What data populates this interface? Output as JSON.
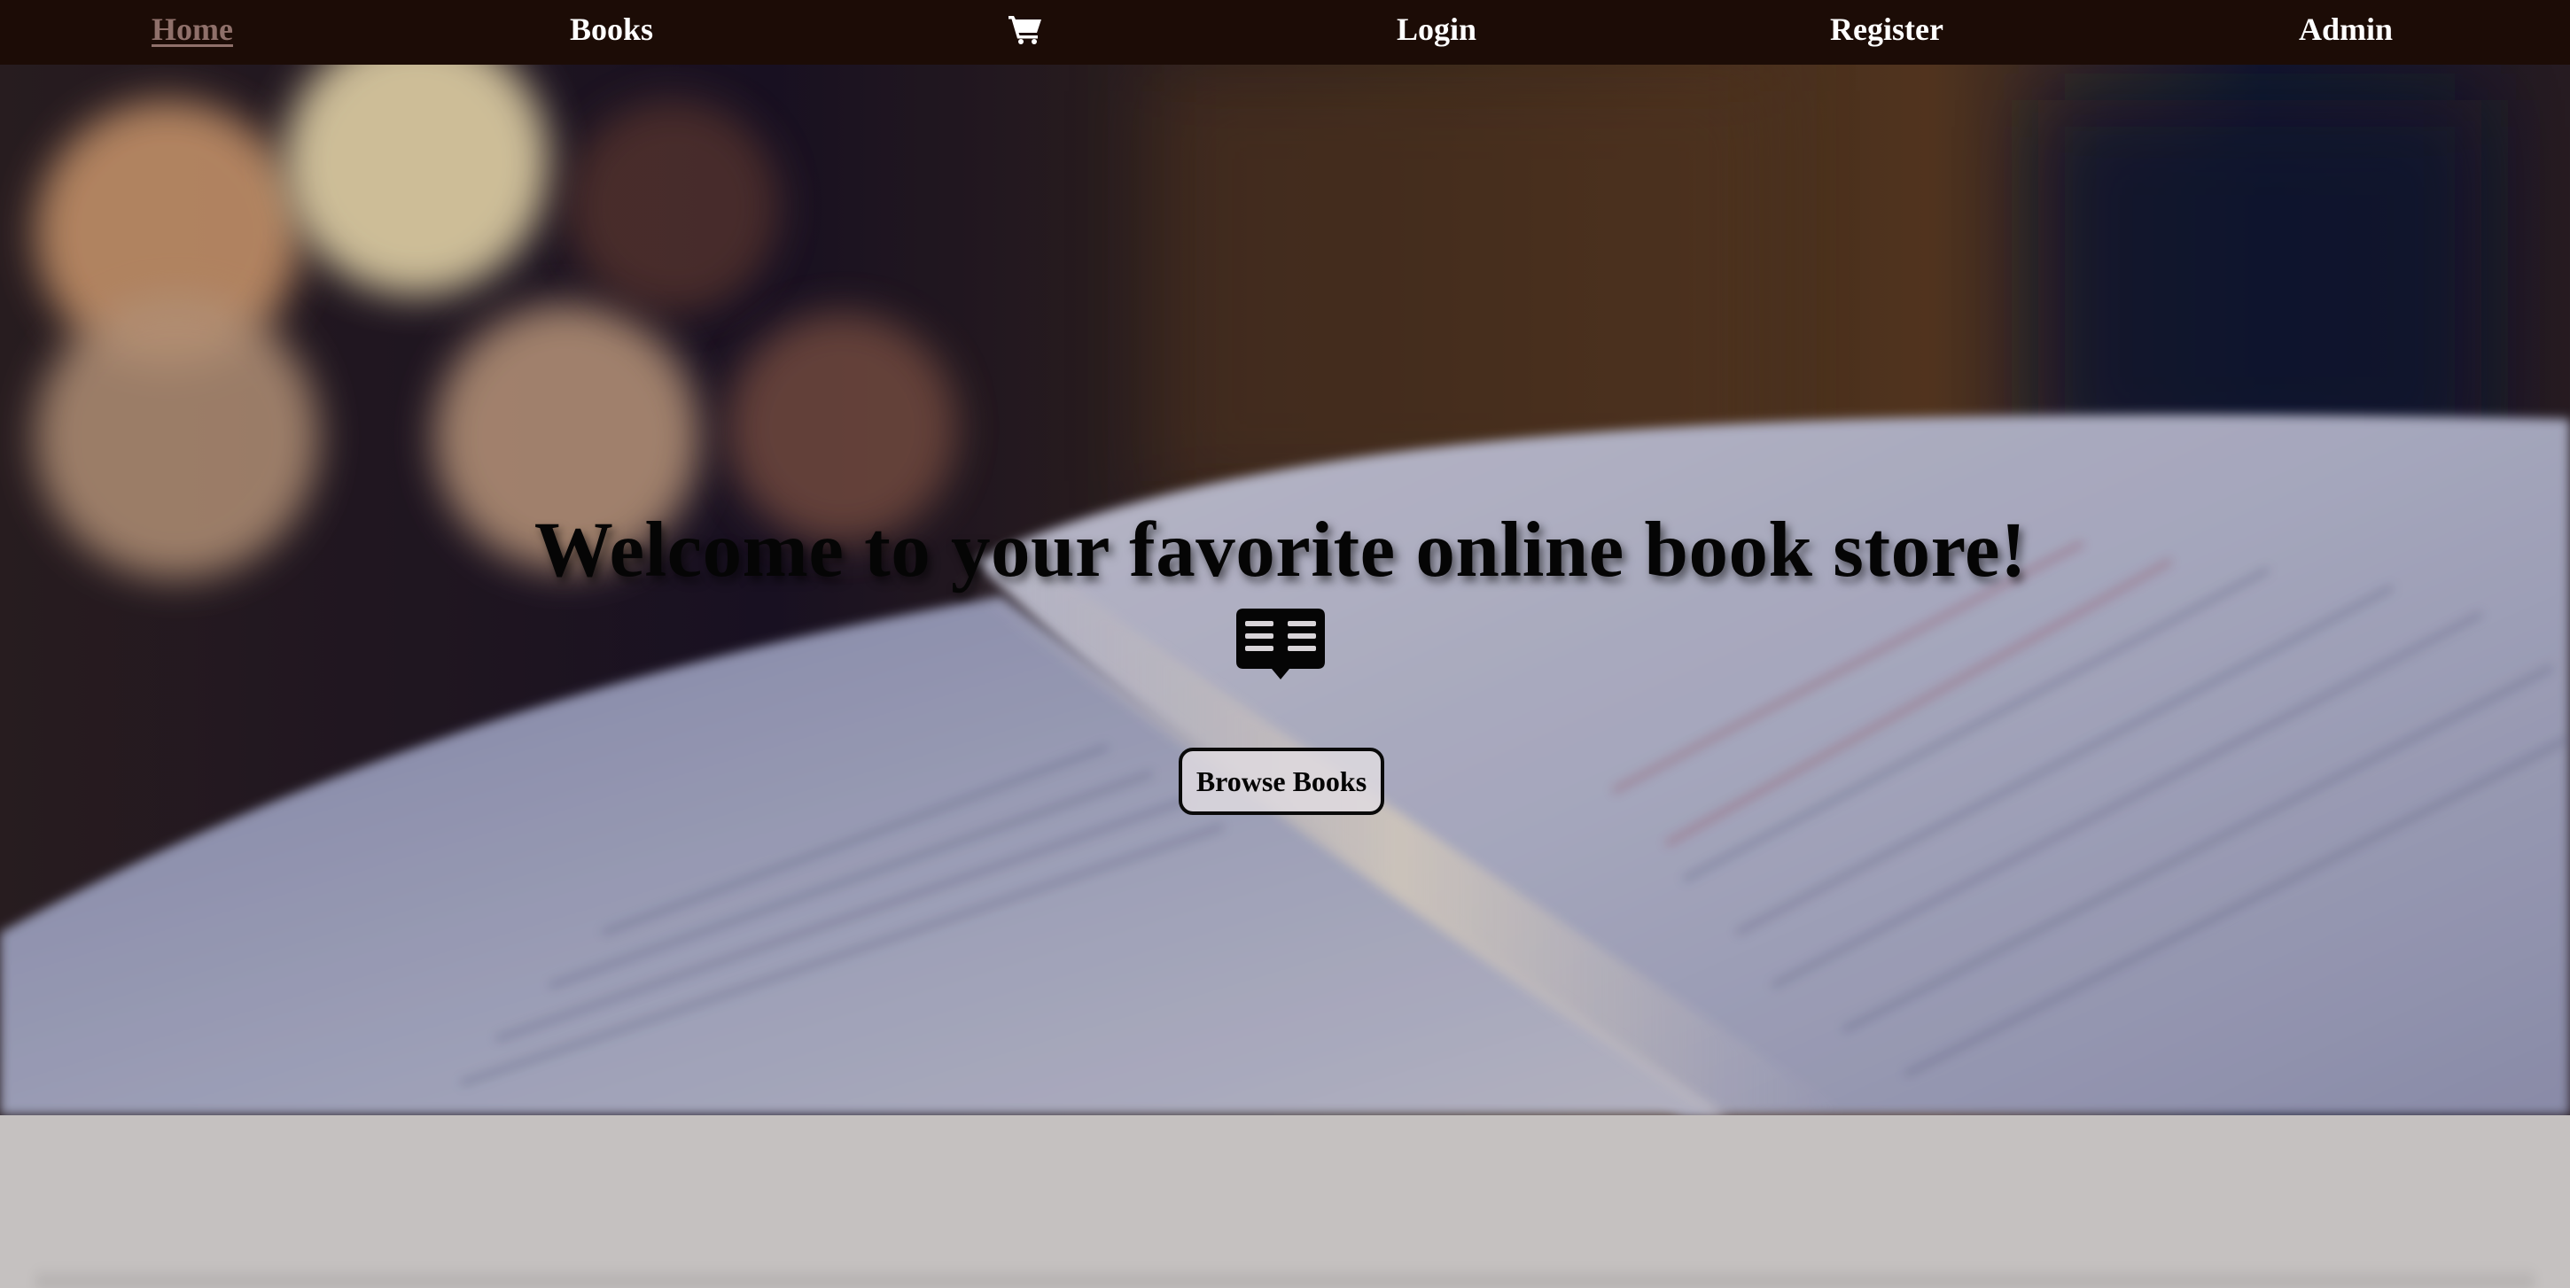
{
  "nav": {
    "items": [
      {
        "label": "Home",
        "active": true
      },
      {
        "label": "Books",
        "active": false
      },
      {
        "label": "Login",
        "active": false
      },
      {
        "label": "Register",
        "active": false
      },
      {
        "label": "Admin",
        "active": false
      }
    ],
    "cart_icon": "shopping-cart-icon"
  },
  "hero": {
    "title": "Welcome to your favorite online book store!",
    "icon": "open-book-icon",
    "button_label": "Browse Books"
  },
  "colors": {
    "navbar_bg": "#1c0c06",
    "nav_text": "#ffffff",
    "nav_active": "#8f706a",
    "page_bg": "#c5c1c0"
  }
}
